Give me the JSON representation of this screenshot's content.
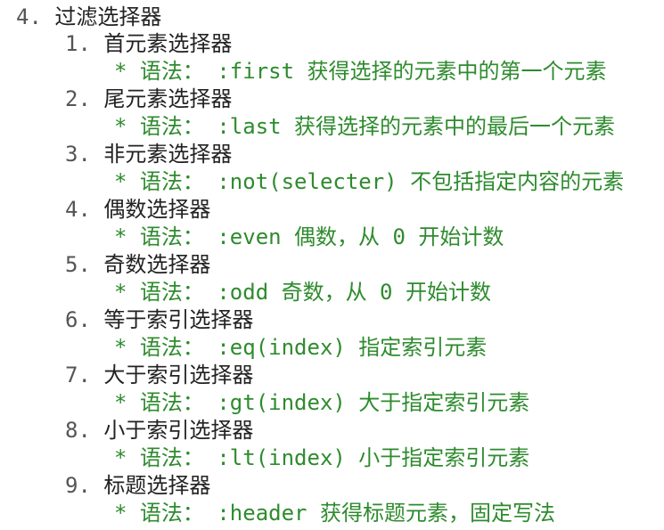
{
  "section": {
    "number": "4.",
    "title": "过滤选择器"
  },
  "items": [
    {
      "number": "1.",
      "title": "首元素选择器",
      "syntax": "* 语法： :first 获得选择的元素中的第一个元素"
    },
    {
      "number": "2.",
      "title": "尾元素选择器",
      "syntax": "* 语法： :last 获得选择的元素中的最后一个元素"
    },
    {
      "number": "3.",
      "title": "非元素选择器",
      "syntax": "* 语法： :not(selecter) 不包括指定内容的元素"
    },
    {
      "number": "4.",
      "title": "偶数选择器",
      "syntax": "* 语法： :even 偶数，从 0 开始计数"
    },
    {
      "number": "5.",
      "title": "奇数选择器",
      "syntax": "* 语法： :odd 奇数，从 0 开始计数"
    },
    {
      "number": "6.",
      "title": "等于索引选择器",
      "syntax": "* 语法： :eq(index) 指定索引元素"
    },
    {
      "number": "7.",
      "title": "大于索引选择器",
      "syntax": "* 语法： :gt(index) 大于指定索引元素"
    },
    {
      "number": "8.",
      "title": "小于索引选择器",
      "syntax": "* 语法： :lt(index) 小于指定索引元素"
    },
    {
      "number": "9.",
      "title": "标题选择器",
      "syntax": "* 语法： :header 获得标题元素，固定写法"
    }
  ],
  "colors": {
    "text": "#222222",
    "syntax": "#2e8b2e",
    "background": "#ffffff"
  }
}
